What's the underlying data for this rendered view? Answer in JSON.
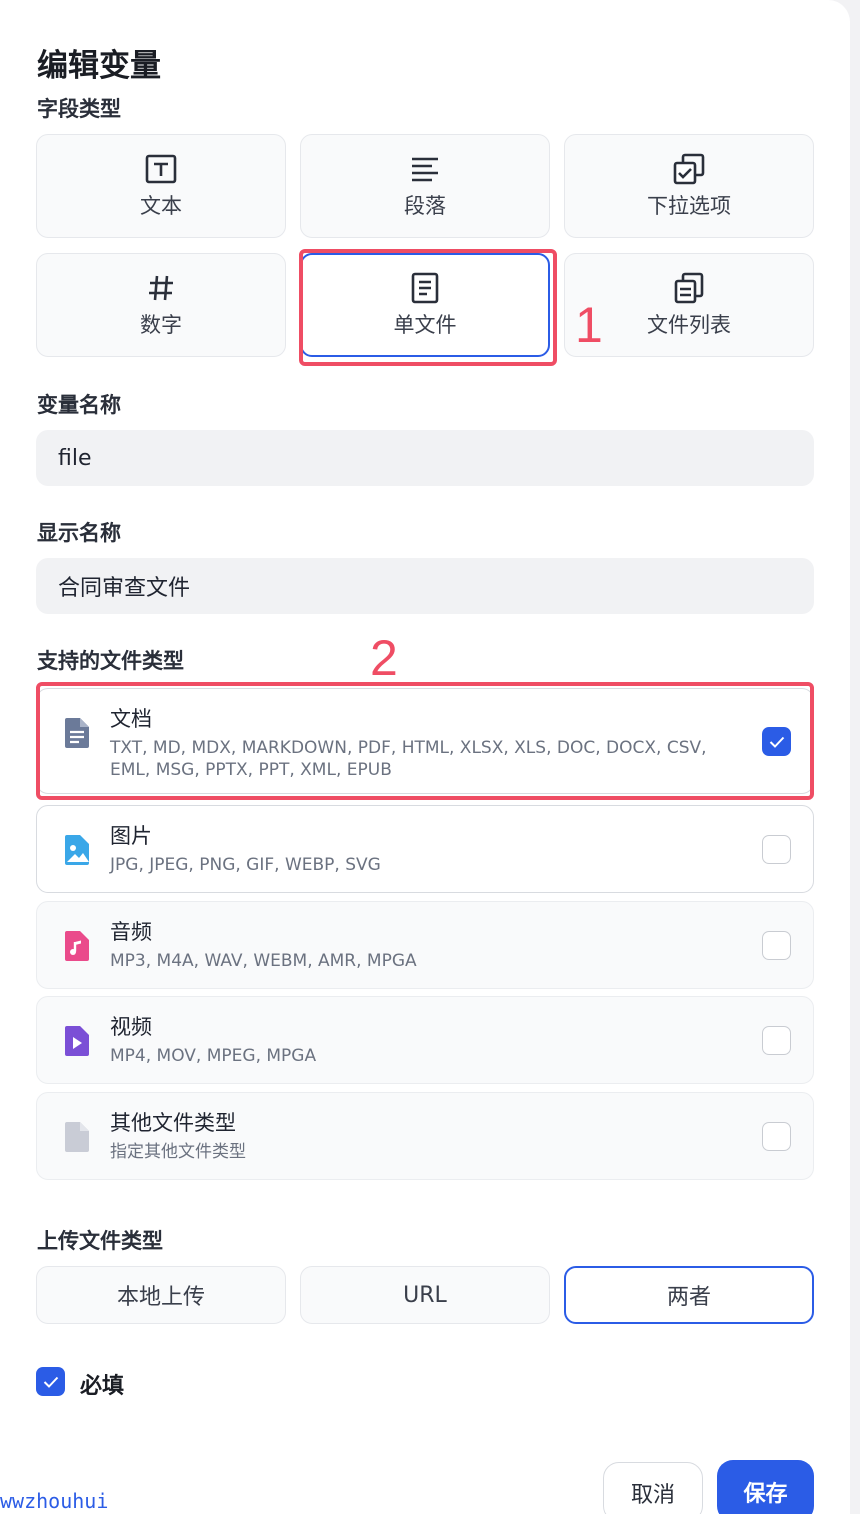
{
  "dialog": {
    "title": "编辑变量"
  },
  "field_type": {
    "label": "字段类型",
    "options": [
      {
        "label": "文本",
        "icon": "text-box-icon"
      },
      {
        "label": "段落",
        "icon": "paragraph-lines-icon"
      },
      {
        "label": "下拉选项",
        "icon": "select-copy-check-icon"
      },
      {
        "label": "数字",
        "icon": "hash-icon"
      },
      {
        "label": "单文件",
        "icon": "document-icon",
        "selected": true
      },
      {
        "label": "文件列表",
        "icon": "file-list-icon"
      }
    ]
  },
  "variable_name": {
    "label": "变量名称",
    "value": "file"
  },
  "display_name": {
    "label": "显示名称",
    "value": "合同审查文件"
  },
  "file_types": {
    "label": "支持的文件类型",
    "items": [
      {
        "name": "文档",
        "desc": "TXT, MD, MDX, MARKDOWN, PDF, HTML, XLSX, XLS, DOC, DOCX, CSV, EML, MSG, PPTX, PPT, XML, EPUB",
        "checked": true,
        "icon": "document-type-icon"
      },
      {
        "name": "图片",
        "desc": "JPG, JPEG, PNG, GIF, WEBP, SVG",
        "checked": false,
        "icon": "image-type-icon"
      },
      {
        "name": "音频",
        "desc": "MP3, M4A, WAV, WEBM, AMR, MPGA",
        "checked": false,
        "icon": "audio-type-icon"
      },
      {
        "name": "视频",
        "desc": "MP4, MOV, MPEG, MPGA",
        "checked": false,
        "icon": "video-type-icon"
      },
      {
        "name": "其他文件类型",
        "desc": "指定其他文件类型",
        "checked": false,
        "icon": "other-file-icon"
      }
    ]
  },
  "upload_method": {
    "label": "上传文件类型",
    "options": [
      {
        "label": "本地上传"
      },
      {
        "label": "URL"
      },
      {
        "label": "两者",
        "selected": true
      }
    ]
  },
  "required": {
    "label": "必填",
    "checked": true
  },
  "footer": {
    "cancel_label": "取消",
    "save_label": "保存"
  },
  "annotations": [
    "1",
    "2"
  ],
  "watermark": "wwzhouhui",
  "colors": {
    "accent": "#2b5ce6",
    "annotation": "#ef4d64",
    "doc_icon": "#6b7a99",
    "image_icon": "#3aa7e8",
    "audio_icon": "#ea4b8b",
    "video_icon": "#7b4fd6",
    "other_icon": "#c9ccd6"
  }
}
